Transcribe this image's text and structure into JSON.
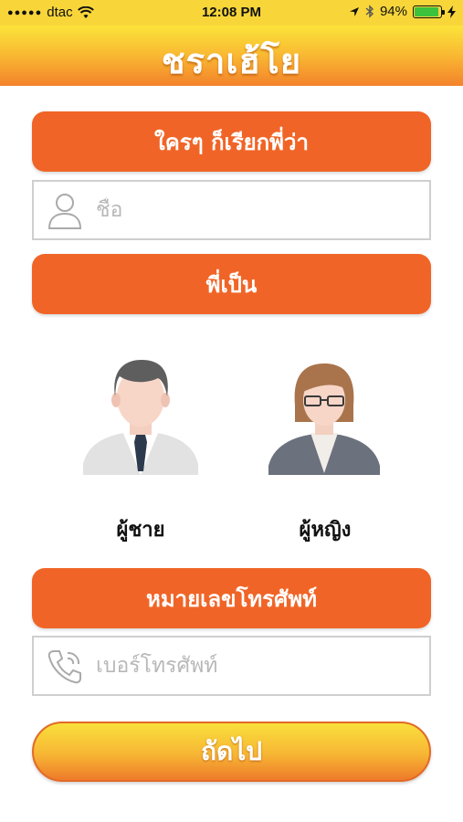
{
  "status_bar": {
    "carrier": "dtac",
    "time": "12:08 PM",
    "battery_percent": "94%"
  },
  "header": {
    "title": "ชราเฮ้โย"
  },
  "form": {
    "nickname_heading": "ใครๆ ก็เรียกพี่ว่า",
    "name_placeholder": "ชื่อ",
    "gender_heading": "พี่เป็น",
    "male_label": "ผู้ชาย",
    "female_label": "ผู้หญิง",
    "phone_heading": "หมายเลขโทรศัพท์",
    "phone_placeholder": "เบอร์โทรศัพท์",
    "next_label": "ถัดไป"
  },
  "colors": {
    "accent_orange": "#f06527",
    "header_yellow": "#fbe43a"
  }
}
